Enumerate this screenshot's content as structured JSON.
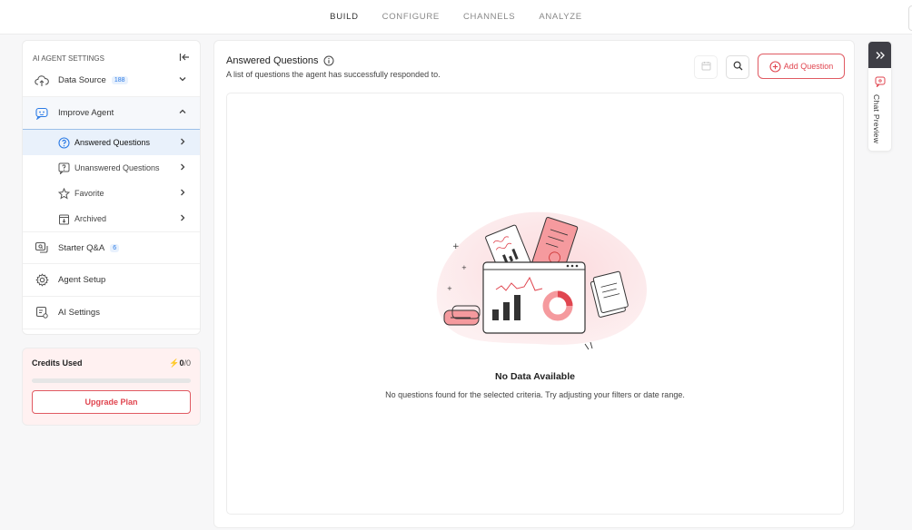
{
  "nav": {
    "tabs": [
      {
        "label": "BUILD"
      },
      {
        "label": "CONFIGURE"
      },
      {
        "label": "CHANNELS"
      },
      {
        "label": "ANALYZE"
      }
    ],
    "active": "BUILD"
  },
  "sidebar": {
    "header": "AI AGENT SETTINGS",
    "data_source": {
      "label": "Data Source",
      "badge": "188"
    },
    "improve_agent": {
      "label": "Improve Agent",
      "sub": [
        {
          "label": "Answered Questions",
          "icon": "question-circle-icon"
        },
        {
          "label": "Unanswered Questions",
          "icon": "chat-question-icon"
        },
        {
          "label": "Favorite",
          "icon": "star-icon"
        },
        {
          "label": "Archived",
          "icon": "archive-icon"
        }
      ]
    },
    "starter_qa": {
      "label": "Starter Q&A",
      "badge": "6"
    },
    "agent_setup": {
      "label": "Agent Setup"
    },
    "ai_settings": {
      "label": "AI Settings"
    }
  },
  "credits": {
    "label": "Credits Used",
    "used": "0",
    "total": "/0",
    "progress": 0,
    "upgrade_label": "Upgrade Plan"
  },
  "main": {
    "title": "Answered Questions",
    "subtitle": "A list of questions the agent has successfully responded to.",
    "add_label": "Add Question",
    "empty_title": "No Data Available",
    "empty_sub": "No questions found for the selected criteria. Try adjusting your filters or date range."
  },
  "chat_preview": {
    "label": "Chat Preview"
  },
  "colors": {
    "accent": "#e04650",
    "info": "#2c7be5",
    "dark_tab": "#3f3f46"
  }
}
